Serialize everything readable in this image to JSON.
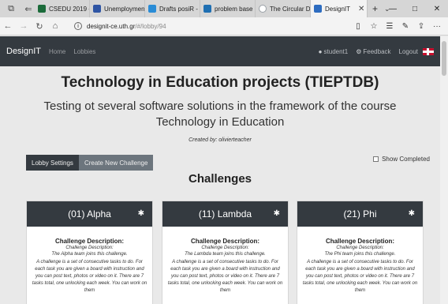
{
  "browser": {
    "tabs": [
      {
        "label": "CSEDU 2019 -",
        "color": "#1b6b3a"
      },
      {
        "label": "Unemploymen",
        "color": "#2f55a4"
      },
      {
        "label": "Drafts posiR -",
        "color": "#2a8cd6"
      },
      {
        "label": "problem base",
        "color": "#1f6fb2"
      },
      {
        "label": "The Circular D",
        "color": "#9aa0a6"
      },
      {
        "label": "DesignIT",
        "color": "#2d6cc0"
      }
    ],
    "url_host": "designit-ce.uth.gr",
    "url_path": "/#/lobby/94"
  },
  "navbar": {
    "brand": "DesignIT",
    "links": [
      "Home",
      "Lobbies"
    ],
    "user": "student1",
    "feedback": "Feedback",
    "logout": "Logout"
  },
  "page": {
    "title": "Technology in Education projects (TIEPTDB)",
    "subtitle": "Testing ot several software solutions in the framework of the course Technology in Education",
    "created_by": "Created by: olivierteacher",
    "lobby_settings": "Lobby Settings",
    "create_challenge": "Create New Challenge",
    "show_completed": "Show Completed",
    "challenges_heading": "Challenges"
  },
  "cards": [
    {
      "title": "(01) Alpha",
      "desc_title": "Challenge Description:",
      "desc_sub": "Challenge Description:",
      "line1": "The Alpha team joins this challenge.",
      "line2": "A challenge is a set of consecutive tasks to do. For each task you are given a board with instruction and you can post text, photos or video on it. There are 7 tasks total, one unlocking each week. You can work on them"
    },
    {
      "title": "(11) Lambda",
      "desc_title": "Challenge Description:",
      "desc_sub": "Challenge Description:",
      "line1": "The Lambda team joins this challenge.",
      "line2": "A challenge is a set of consecutive tasks to do. For each task you are given a board with instruction and you can post text, photos or video on it. There are 7 tasks total, one unlocking each week. You can work on them"
    },
    {
      "title": "(21) Phi",
      "desc_title": "Challenge Description:",
      "desc_sub": "Challenge Description:",
      "line1": "The Phi team joins this challenge.",
      "line2": "A challenge is a set of consecutive tasks to do. For each task you are given a board with instruction and you can post text, photos or video on it. There are 7 tasks total, one unlocking each week. You can work on them"
    }
  ]
}
